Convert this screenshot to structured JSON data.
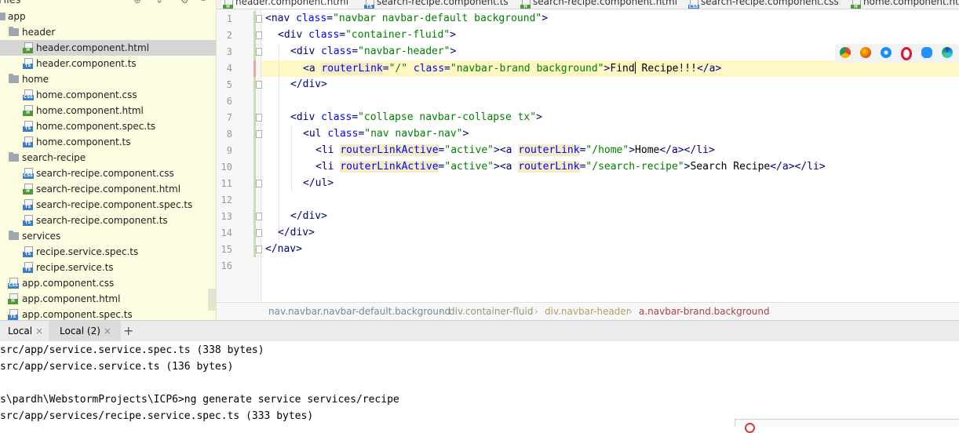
{
  "project_tree": {
    "header_title": "Files",
    "items": [
      {
        "label": "app",
        "type": "folder"
      },
      {
        "label": "header",
        "type": "folder"
      },
      {
        "label": "header.component.html",
        "type": "html",
        "selected": true
      },
      {
        "label": "header.component.ts",
        "type": "ts"
      },
      {
        "label": "home",
        "type": "folder"
      },
      {
        "label": "home.component.css",
        "type": "css"
      },
      {
        "label": "home.component.html",
        "type": "html"
      },
      {
        "label": "home.component.spec.ts",
        "type": "ts"
      },
      {
        "label": "home.component.ts",
        "type": "ts"
      },
      {
        "label": "search-recipe",
        "type": "folder"
      },
      {
        "label": "search-recipe.component.css",
        "type": "css"
      },
      {
        "label": "search-recipe.component.html",
        "type": "html"
      },
      {
        "label": "search-recipe.component.spec.ts",
        "type": "ts"
      },
      {
        "label": "search-recipe.component.ts",
        "type": "ts"
      },
      {
        "label": "services",
        "type": "folder"
      },
      {
        "label": "recipe.service.spec.ts",
        "type": "ts"
      },
      {
        "label": "recipe.service.ts",
        "type": "ts"
      },
      {
        "label": "app.component.css",
        "type": "css"
      },
      {
        "label": "app.component.html",
        "type": "html"
      },
      {
        "label": "app.component.spec.ts",
        "type": "ts"
      }
    ]
  },
  "editor_tabs": [
    {
      "label": "header.component.html",
      "type": "html",
      "active": true
    },
    {
      "label": "search-recipe.component.ts",
      "type": "ts"
    },
    {
      "label": "search-recipe.component.html",
      "type": "html"
    },
    {
      "label": "search-recipe.component.css",
      "type": "css"
    },
    {
      "label": "home.component.html",
      "type": "html"
    }
  ],
  "code": {
    "line_numbers": [
      "1",
      "2",
      "3",
      "4",
      "5",
      "6",
      "7",
      "8",
      "9",
      "10",
      "11",
      "12",
      "13",
      "14",
      "15",
      "16"
    ],
    "l1": {
      "a": "<nav ",
      "b": "class",
      "c": "=",
      "d": "\"navbar navbar-default background\"",
      "e": ">"
    },
    "l2": {
      "a": "<div ",
      "b": "class",
      "c": "=",
      "d": "\"container-fluid\"",
      "e": ">"
    },
    "l3": {
      "a": "<div ",
      "b": "class",
      "c": "=",
      "d": "\"navbar-header\"",
      "e": ">"
    },
    "l4": {
      "a": "<a ",
      "b": "routerLink",
      "c": "=",
      "d": "\"/\"",
      "sp": " ",
      "f": "class",
      "g": "=",
      "h": "\"navbar-brand background\"",
      "i": ">",
      "t1": "Find",
      "t2": " Recipe!!!",
      "j": "</a>"
    },
    "l5": "</div>",
    "l7": {
      "a": "<div ",
      "b": "class",
      "c": "=",
      "d": "\"collapse navbar-collapse tx\"",
      "e": ">"
    },
    "l8": {
      "a": "<ul ",
      "b": "class",
      "c": "=",
      "d": "\"nav navbar-nav\"",
      "e": ">"
    },
    "l9": {
      "a": "<li ",
      "b": "routerLinkActive",
      "c": "=",
      "d": "\"active\"",
      "e": "><a ",
      "f": "routerLink",
      "g": "=",
      "h": "\"/home\"",
      "i": ">",
      "t": "Home",
      "j": "</a></li>"
    },
    "l10": {
      "a": "<li ",
      "b": "routerLinkActive",
      "c": "=",
      "d": "\"active\"",
      "e": "><a ",
      "f": "routerLink",
      "g": "=",
      "h": "\"/search-recipe\"",
      "i": ">",
      "t": "Search Recipe",
      "j": "</a></li>"
    },
    "l11": "</ul>",
    "l13": "</div>",
    "l14": "</div>",
    "l15": "</nav>"
  },
  "breadcrumbs": [
    {
      "label": "nav.navbar.navbar-default.background",
      "color": "#6b8e9e"
    },
    {
      "label": "div.container-fluid",
      "color": "#8aa06a"
    },
    {
      "label": "div.navbar-header",
      "color": "#b0a060"
    },
    {
      "label": "a.navbar-brand.background",
      "color": "#b04040"
    }
  ],
  "browsers": [
    "chrome-icon",
    "firefox-icon",
    "safari-icon",
    "opera-icon",
    "ie-icon",
    "edge-icon"
  ],
  "terminal": {
    "tabs": [
      {
        "label": "Local",
        "active": false
      },
      {
        "label": "Local (2)",
        "active": true
      }
    ],
    "add_label": "+",
    "lines": [
      "src/app/service.service.spec.ts (338 bytes)",
      "src/app/service.service.ts (136 bytes)",
      "",
      "s\\pardh\\WebstormProjects\\ICP6>ng generate service services/recipe",
      "src/app/services/recipe.service.spec.ts (333 bytes)"
    ]
  },
  "colors": {
    "tree_bg": "#fdfde1",
    "tag": "#000080",
    "attr": "#0000ff",
    "value": "#008000",
    "current_line": "#fff8c5"
  }
}
